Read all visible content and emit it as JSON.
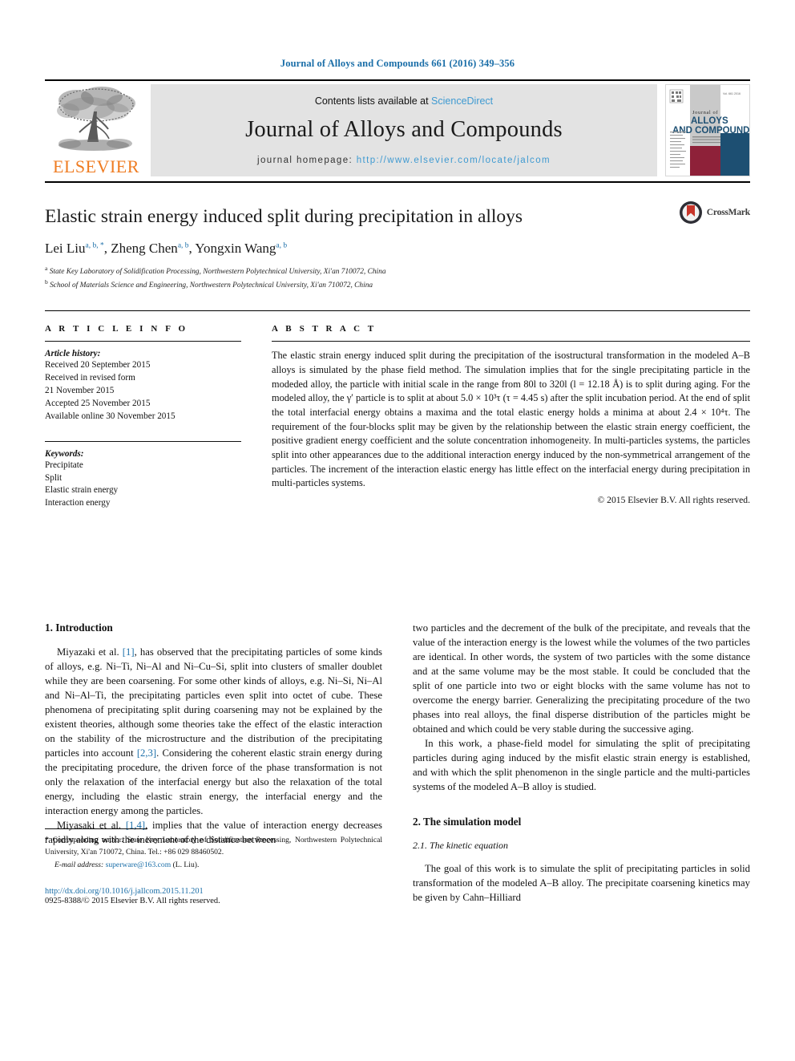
{
  "running_head": "Journal of Alloys and Compounds 661 (2016) 349–356",
  "masthead": {
    "publisher_name": "ELSEVIER",
    "contents_prefix": "Contents lists available at ",
    "contents_link": "ScienceDirect",
    "journal_name": "Journal of Alloys and Compounds",
    "homepage_prefix": "journal homepage: ",
    "homepage_url": "http://www.elsevier.com/locate/jalcom",
    "cover": {
      "line1": "Journal of",
      "line2": "ALLOYS",
      "line3": "AND COMPOUNDS",
      "red_hex": "#8e2139",
      "blue_hex": "#1d4f72"
    }
  },
  "title_block": {
    "title": "Elastic strain energy induced split during precipitation in alloys",
    "authors": [
      {
        "name": "Lei Liu",
        "sup": "a, b, *"
      },
      {
        "name": "Zheng Chen",
        "sup": "a, b"
      },
      {
        "name": "Yongxin Wang",
        "sup": "a, b"
      }
    ],
    "affiliations": [
      {
        "mark": "a",
        "text": "State Key Laboratory of Solidification Processing, Northwestern Polytechnical University, Xi'an 710072, China"
      },
      {
        "mark": "b",
        "text": "School of Materials Science and Engineering, Northwestern Polytechnical University, Xi'an 710072, China"
      }
    ],
    "crossmark_label": "CrossMark"
  },
  "article_info": {
    "heading": "A R T I C L E  I N F O",
    "history_label": "Article history:",
    "history": [
      "Received 20 September 2015",
      "Received in revised form",
      "21 November 2015",
      "Accepted 25 November 2015",
      "Available online 30 November 2015"
    ],
    "keywords_label": "Keywords:",
    "keywords": [
      "Precipitate",
      "Split",
      "Elastic strain energy",
      "Interaction energy"
    ]
  },
  "abstract": {
    "heading": "A B S T R A C T",
    "text": "The elastic strain energy induced split during the precipitation of the isostructural transformation in the modeled A–B alloys is simulated by the phase field method. The simulation implies that for the single precipitating particle in the modeded alloy, the particle with initial scale in the range from 80l to 320l (l = 12.18 Å) is to split during aging. For the modeled alloy, the γ′ particle is to split at about 5.0 × 10³τ (τ = 4.45 s) after the split incubation period. At the end of split the total interfacial energy obtains a maxima and the total elastic energy holds a minima at about 2.4 × 10⁴τ. The requirement of the four-blocks split may be given by the relationship between the elastic strain energy coefficient, the positive gradient energy coefficient and the solute concentration inhomogeneity. In multi-particles systems, the particles split into other appearances due to the additional interaction energy induced by the non-symmetrical arrangement of the particles. The increment of the interaction elastic energy has little effect on the interfacial energy during precipitation in multi-particles systems.",
    "copyright": "© 2015 Elsevier B.V. All rights reserved."
  },
  "body": {
    "section1_heading": "1. Introduction",
    "left_p1_a": "Miyazaki et al. ",
    "left_p1_ref1": "[1]",
    "left_p1_b": ", has observed that the precipitating particles of some kinds of alloys, e.g. Ni–Ti, Ni–Al and Ni–Cu–Si, split into clusters of smaller doublet while they are been coarsening. For some other kinds of alloys, e.g. Ni–Si, Ni–Al and Ni–Al–Ti, the precipitating particles even split into octet of cube. These phenomena of precipitating split during coarsening may not be explained by the existent theories, although some theories take the effect of the elastic interaction on the stability of the microstructure and the distribution of the precipitating particles into account ",
    "left_p1_ref2": "[2,3]",
    "left_p1_c": ". Considering the coherent elastic strain energy during the precipitating procedure, the driven force of the phase transformation is not only the relaxation of the interfacial energy but also the relaxation of the total energy, including the elastic strain energy, the interfacial energy and the interaction energy among the particles.",
    "left_p2_a": "Miyasaki et al. ",
    "left_p2_ref": "[1,4]",
    "left_p2_b": ", implies that the value of interaction energy decreases rapidly along with the increment of the distance between",
    "right_p1": "two particles and the decrement of the bulk of the precipitate, and reveals that the value of the interaction energy is the lowest while the volumes of the two particles are identical. In other words, the system of two particles with the some distance and at the same volume may be the most stable. It could be concluded that the split of one particle into two or eight blocks with the same volume has not to overcome the energy barrier. Generalizing the precipitating procedure of the two phases into real alloys, the final disperse distribution of the particles might be obtained and which could be very stable during the successive aging.",
    "right_p2": "In this work, a phase-field model for simulating the split of precipitating particles during aging induced by the misfit elastic strain energy is established, and with which the split phenomenon in the single particle and the multi-particles systems of the modeled A–B alloy is studied.",
    "section2_heading": "2. The simulation model",
    "section21_heading": "2.1. The kinetic equation",
    "right_p3": "The goal of this work is to simulate the split of precipitating particles in solid transformation of the modeled A–B alloy. The precipitate coarsening kinetics may be given by Cahn–Hilliard"
  },
  "footnotes": {
    "corresponding_star": "*",
    "corresponding_text": " Corresponding author. State Key Laboratory of Solidification Processing, Northwestern Polytechnical University, Xi'an 710072, China. Tel.: +86 029 88460502.",
    "email_label": "E-mail address:",
    "email": "superware@163.com",
    "email_suffix": "(L. Liu).",
    "doi": "http://dx.doi.org/10.1016/j.jallcom.2015.11.201",
    "issn": "0925-8388/© 2015 Elsevier B.V. All rights reserved."
  }
}
